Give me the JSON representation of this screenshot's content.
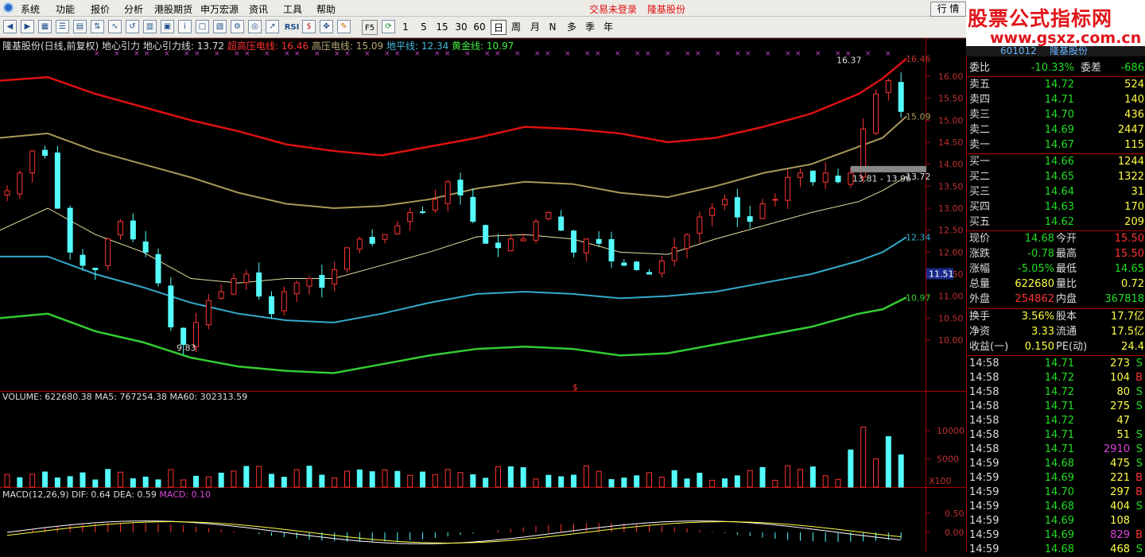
{
  "menu": {
    "items": [
      "系统",
      "功能",
      "报价",
      "分析",
      "港股期货",
      "申万宏源",
      "资讯",
      "工具",
      "帮助"
    ],
    "login_status": "交易未登录",
    "stock_name": "隆基股份",
    "right_tab": "行 情"
  },
  "toolbar": {
    "periods": [
      "1",
      "5",
      "15",
      "30",
      "60",
      "日",
      "周",
      "月",
      "N",
      "多",
      "季",
      "年"
    ],
    "icons": [
      "RSI",
      "F5"
    ]
  },
  "brand": {
    "title": "股票公式指标网",
    "url": "www.gsxz.com.cn",
    "code": "601012",
    "name": "隆基股份"
  },
  "main_title": {
    "stock": "隆基股份(日线,前复权)",
    "indicator": "地心引力",
    "line1": "地心引力线: 13.72",
    "line2": "超高压电线: 16.46",
    "line3": "高压电线: 15.09",
    "line4": "地平线: 12.34",
    "line5": "黄金线: 10.97"
  },
  "price_axis": [
    "16.00",
    "15.50",
    "15.00",
    "14.50",
    "14.00",
    "13.50",
    "13.00",
    "12.50",
    "12.00",
    "11.50",
    "11.00",
    "10.50",
    "10.00"
  ],
  "price_axis_right_labels": {
    "top": "16.46",
    "a": "15.09",
    "b": "13.72",
    "c": "12.34",
    "d": "10.97",
    "cursor": "11.51"
  },
  "annotations": {
    "high": "16.37",
    "low": "9.83",
    "range": "13.81 - 13.96",
    "mid": "$"
  },
  "volume": {
    "title": "VOLUME: 622680.38",
    "ma5": "MA5: 767254.38",
    "ma60": "MA60: 302313.59",
    "axis": [
      "10000",
      "5000"
    ],
    "unit": "X100"
  },
  "macd": {
    "title": "MACD(12,26,9)",
    "dif": "DIF: 0.64",
    "dea": "DEA: 0.59",
    "macd": "MACD: 0.10",
    "axis": [
      "0.50",
      "0.00"
    ]
  },
  "order_book": {
    "weibi_label": "委比",
    "weibi": "-10.33%",
    "weicha_label": "委差",
    "weicha": "-686",
    "sells": [
      {
        "label": "卖五",
        "price": "14.72",
        "vol": "524"
      },
      {
        "label": "卖四",
        "price": "14.71",
        "vol": "140"
      },
      {
        "label": "卖三",
        "price": "14.70",
        "vol": "436"
      },
      {
        "label": "卖二",
        "price": "14.69",
        "vol": "2447"
      },
      {
        "label": "卖一",
        "price": "14.67",
        "vol": "115"
      }
    ],
    "buys": [
      {
        "label": "买一",
        "price": "14.66",
        "vol": "1244"
      },
      {
        "label": "买二",
        "price": "14.65",
        "vol": "1322"
      },
      {
        "label": "买三",
        "price": "14.64",
        "vol": "31"
      },
      {
        "label": "买四",
        "price": "14.63",
        "vol": "170"
      },
      {
        "label": "买五",
        "price": "14.62",
        "vol": "209"
      }
    ]
  },
  "stats": [
    {
      "l1": "现价",
      "v1": "14.68",
      "l2": "今开",
      "v2": "15.50",
      "c1": "#22dd22",
      "c2": "#ff3333"
    },
    {
      "l1": "涨跌",
      "v1": "-0.78",
      "l2": "最高",
      "v2": "15.50",
      "c1": "#22dd22",
      "c2": "#ff3333"
    },
    {
      "l1": "涨幅",
      "v1": "-5.05%",
      "l2": "最低",
      "v2": "14.65",
      "c1": "#22dd22",
      "c2": "#22dd22"
    },
    {
      "l1": "总量",
      "v1": "622680",
      "l2": "量比",
      "v2": "0.72",
      "c1": "#ffff44",
      "c2": "#ffff44"
    },
    {
      "l1": "外盘",
      "v1": "254862",
      "l2": "内盘",
      "v2": "367818",
      "c1": "#ff3333",
      "c2": "#22dd22"
    },
    {
      "l1": "换手",
      "v1": "3.56%",
      "l2": "股本",
      "v2": "17.7亿",
      "c1": "#ffff44",
      "c2": "#ffff44"
    },
    {
      "l1": "净资",
      "v1": "3.33",
      "l2": "流通",
      "v2": "17.5亿",
      "c1": "#ffff44",
      "c2": "#ffff44"
    },
    {
      "l1": "收益(一)",
      "v1": "0.150",
      "l2": "PE(动)",
      "v2": "24.4",
      "c1": "#ffff44",
      "c2": "#ffff44"
    }
  ],
  "ticks": [
    {
      "t": "14:58",
      "p": "14.71",
      "v": "273",
      "s": "S"
    },
    {
      "t": "14:58",
      "p": "14.72",
      "v": "104",
      "s": "B"
    },
    {
      "t": "14:58",
      "p": "14.72",
      "v": "80",
      "s": "S"
    },
    {
      "t": "14:58",
      "p": "14.71",
      "v": "275",
      "s": "S"
    },
    {
      "t": "14:58",
      "p": "14.72",
      "v": "47",
      "s": ""
    },
    {
      "t": "14:58",
      "p": "14.71",
      "v": "51",
      "s": "S"
    },
    {
      "t": "14:58",
      "p": "14.71",
      "v": "2910",
      "s": "S"
    },
    {
      "t": "14:59",
      "p": "14.68",
      "v": "475",
      "s": "S"
    },
    {
      "t": "14:59",
      "p": "14.69",
      "v": "221",
      "s": "B"
    },
    {
      "t": "14:59",
      "p": "14.70",
      "v": "297",
      "s": "B"
    },
    {
      "t": "14:59",
      "p": "14.68",
      "v": "404",
      "s": "S"
    },
    {
      "t": "14:59",
      "p": "14.69",
      "v": "108",
      "s": ""
    },
    {
      "t": "14:59",
      "p": "14.69",
      "v": "829",
      "s": "B"
    },
    {
      "t": "14:59",
      "p": "14.68",
      "v": "468",
      "s": "S"
    }
  ],
  "colors": {
    "up": "#ff3333",
    "down": "#54fcfc",
    "line_red": "#dd1111",
    "line_olive": "#a89858",
    "line_cyan": "#33aacc",
    "line_green": "#33cc33",
    "ma_yellow": "#e8e0a0"
  }
}
